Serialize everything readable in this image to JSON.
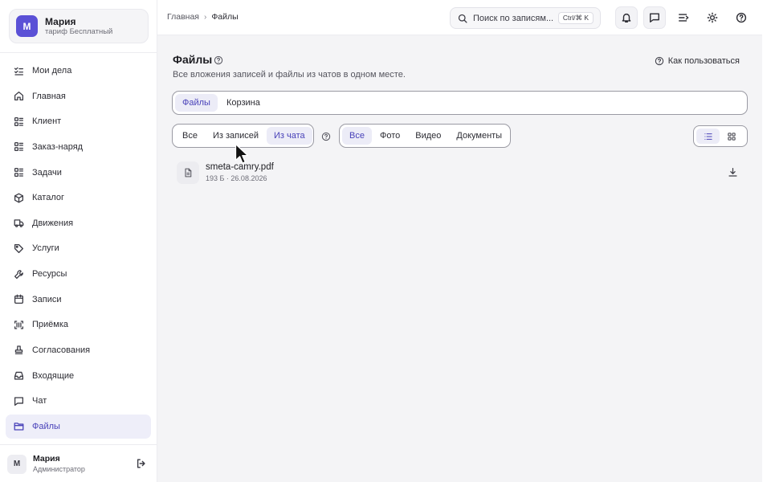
{
  "account": {
    "avatar_letter": "М",
    "name": "Мария",
    "plan": "тариф Бесплатный"
  },
  "sidebar": {
    "items": [
      {
        "label": "Мои дела",
        "icon": "checklist-icon"
      },
      {
        "label": "Главная",
        "icon": "home-icon"
      },
      {
        "label": "Клиент",
        "icon": "grid-list-icon"
      },
      {
        "label": "Заказ-наряд",
        "icon": "grid-list-icon"
      },
      {
        "label": "Задачи",
        "icon": "grid-list-icon"
      },
      {
        "label": "Каталог",
        "icon": "box-icon"
      },
      {
        "label": "Движения",
        "icon": "truck-icon"
      },
      {
        "label": "Услуги",
        "icon": "tag-icon"
      },
      {
        "label": "Ресурсы",
        "icon": "wrench-icon"
      },
      {
        "label": "Записи",
        "icon": "calendar-icon"
      },
      {
        "label": "Приёмка",
        "icon": "scan-icon"
      },
      {
        "label": "Согласования",
        "icon": "stamp-icon"
      },
      {
        "label": "Входящие",
        "icon": "inbox-icon"
      },
      {
        "label": "Чат",
        "icon": "chat-icon"
      },
      {
        "label": "Файлы",
        "icon": "folder-icon",
        "active": true
      }
    ]
  },
  "user": {
    "avatar_letter": "М",
    "name": "Мария",
    "role": "Администратор"
  },
  "breadcrumb": {
    "home": "Главная",
    "current": "Файлы"
  },
  "search": {
    "placeholder": "Поиск по записям...",
    "shortcut": "Ctrl/⌘ K"
  },
  "page": {
    "title": "Файлы",
    "subtitle": "Все вложения записей и файлы из чатов в одном месте.",
    "how_to": "Как пользоваться"
  },
  "tabs": [
    {
      "label": "Файлы",
      "active": true
    },
    {
      "label": "Корзина",
      "active": false
    }
  ],
  "source_filter": [
    {
      "label": "Все",
      "active": false
    },
    {
      "label": "Из записей",
      "active": false
    },
    {
      "label": "Из чата",
      "active": true
    }
  ],
  "type_filter": [
    {
      "label": "Все",
      "active": true
    },
    {
      "label": "Фото",
      "active": false
    },
    {
      "label": "Видео",
      "active": false
    },
    {
      "label": "Документы",
      "active": false
    }
  ],
  "view_mode": "list",
  "files": [
    {
      "name": "smeta-camry.pdf",
      "meta": "193 Б · 26.08.2026",
      "icon": "document-icon"
    }
  ],
  "colors": {
    "accent": "#4942b9",
    "avatar": "#5b51d6",
    "active_bg": "#ececf7"
  }
}
